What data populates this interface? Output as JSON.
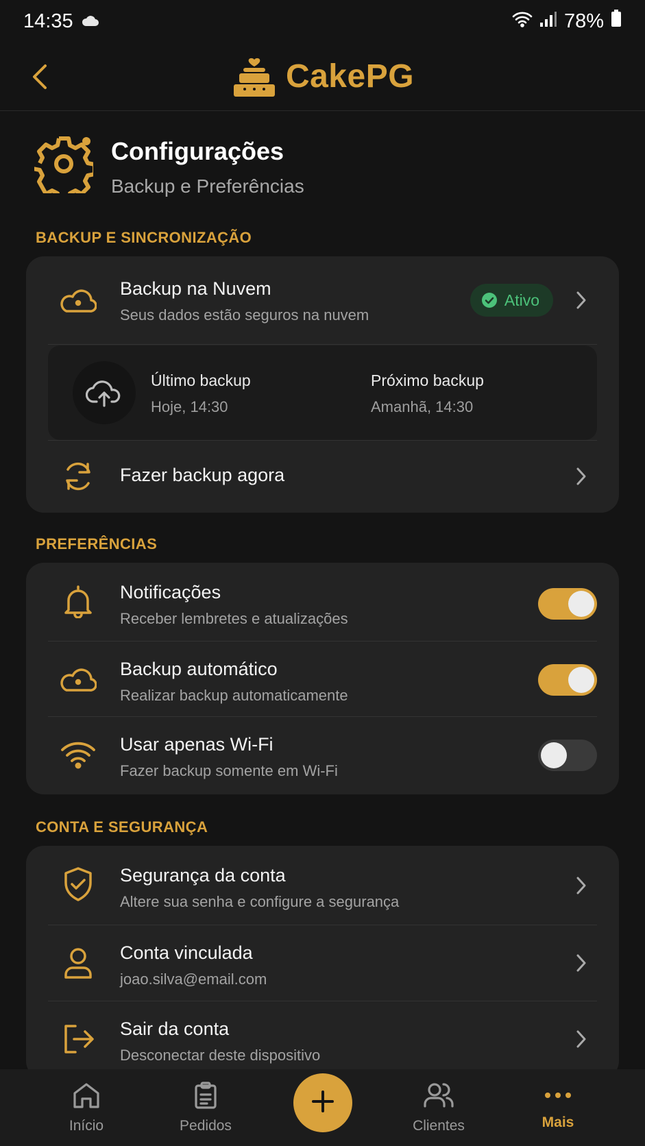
{
  "status_bar": {
    "time": "14:35",
    "battery": "78%"
  },
  "header": {
    "brand": "CakePG"
  },
  "page": {
    "title": "Configurações",
    "subtitle": "Backup e Preferências"
  },
  "sections": {
    "backup": {
      "label": "BACKUP E SINCRONIZAÇÃO",
      "cloud": {
        "title": "Backup na Nuvem",
        "subtitle": "Seus dados estão seguros na nuvem",
        "badge": "Ativo"
      },
      "last": {
        "label": "Último backup",
        "value": "Hoje, 14:30"
      },
      "next": {
        "label": "Próximo backup",
        "value": "Amanhã, 14:30"
      },
      "now": {
        "title": "Fazer backup agora"
      }
    },
    "prefs": {
      "label": "PREFERÊNCIAS",
      "items": [
        {
          "title": "Notificações",
          "subtitle": "Receber lembretes e atualizações",
          "enabled": true
        },
        {
          "title": "Backup automático",
          "subtitle": "Realizar backup automaticamente",
          "enabled": true
        },
        {
          "title": "Usar apenas Wi-Fi",
          "subtitle": "Fazer backup somente em Wi-Fi",
          "enabled": false
        }
      ]
    },
    "account": {
      "label": "CONTA E SEGURANÇA",
      "items": [
        {
          "title": "Segurança da conta",
          "subtitle": "Altere sua senha e configure a segurança"
        },
        {
          "title": "Conta vinculada",
          "subtitle": "joao.silva@email.com"
        },
        {
          "title": "Sair da conta",
          "subtitle": "Desconectar deste dispositivo"
        }
      ]
    }
  },
  "nav": {
    "home": "Início",
    "orders": "Pedidos",
    "clients": "Clientes",
    "more": "Mais"
  },
  "colors": {
    "accent": "#d9a23c",
    "background": "#141414",
    "card": "#232323",
    "success": "#4cc27a"
  }
}
